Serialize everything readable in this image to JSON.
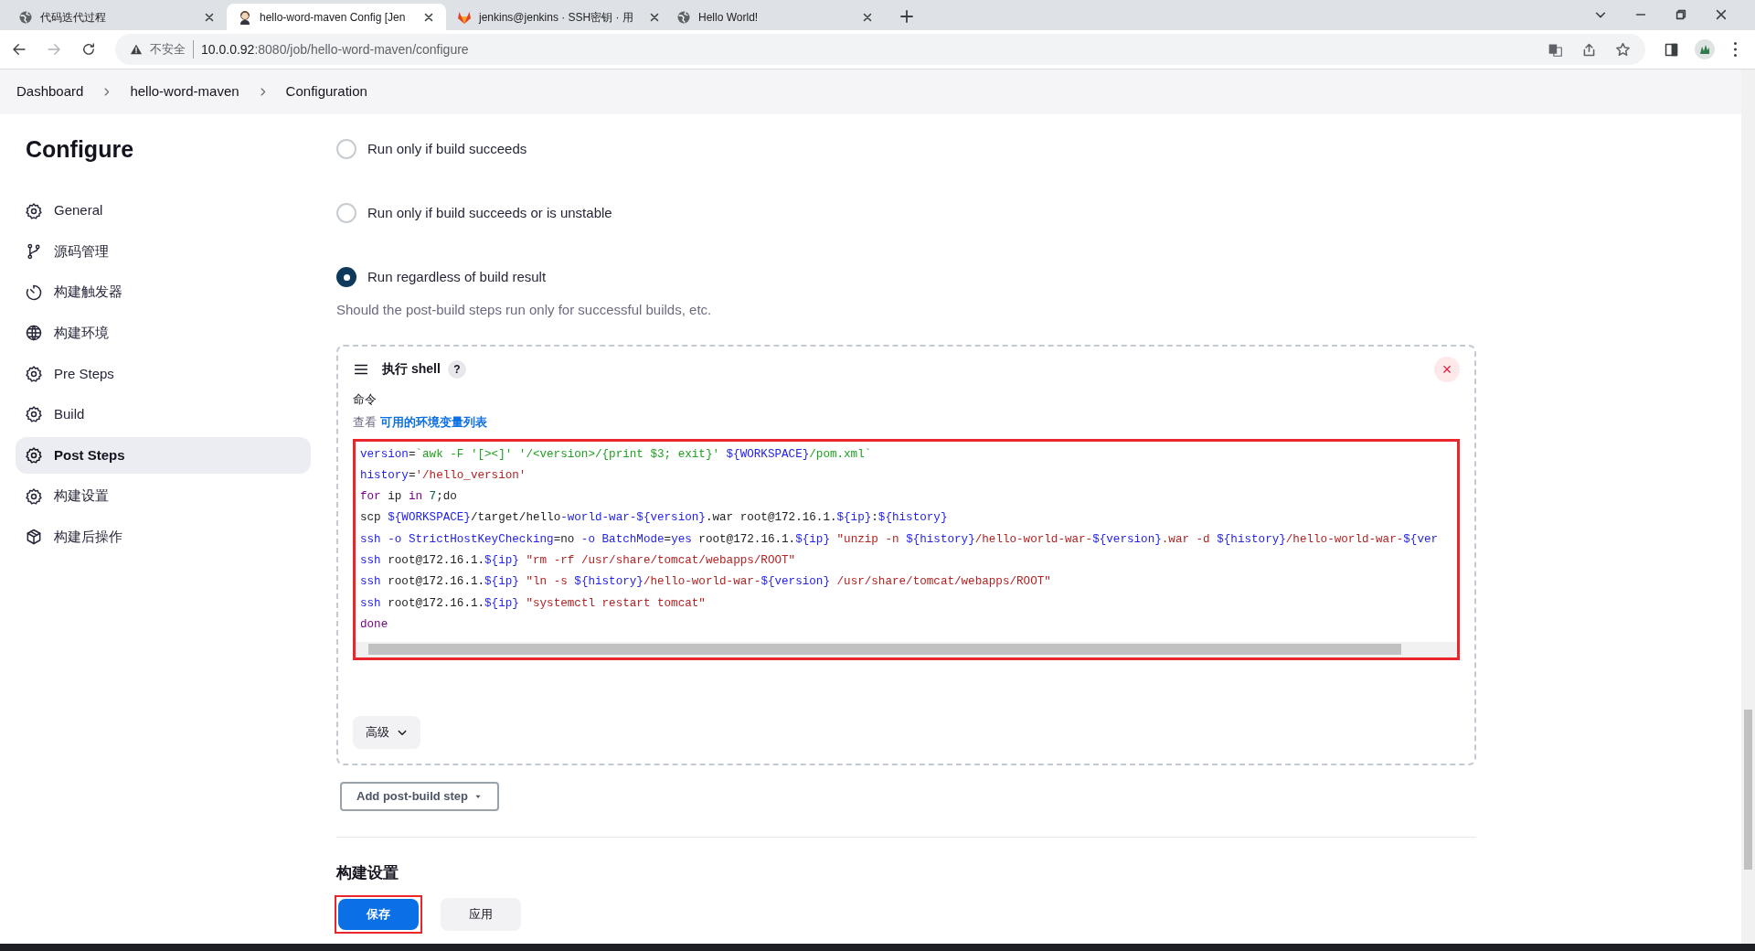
{
  "browser": {
    "tabs": [
      {
        "title": "代码迭代过程",
        "selected": false
      },
      {
        "title": "hello-word-maven Config [Jen",
        "selected": true
      },
      {
        "title": "jenkins@jenkins · SSH密钥 · 用",
        "selected": false
      },
      {
        "title": "Hello World!",
        "selected": false
      }
    ],
    "security": "不安全",
    "url_host": "10.0.0.92",
    "url_rest": ":8080/job/hello-word-maven/configure"
  },
  "breadcrumbs": [
    "Dashboard",
    "hello-word-maven",
    "Configuration"
  ],
  "sidebar": {
    "title": "Configure",
    "items": [
      {
        "label": "General",
        "selected": false
      },
      {
        "label": "源码管理",
        "selected": false
      },
      {
        "label": "构建触发器",
        "selected": false
      },
      {
        "label": "构建环境",
        "selected": false
      },
      {
        "label": "Pre Steps",
        "selected": false
      },
      {
        "label": "Build",
        "selected": false
      },
      {
        "label": "Post Steps",
        "selected": true
      },
      {
        "label": "构建设置",
        "selected": false
      },
      {
        "label": "构建后操作",
        "selected": false
      }
    ]
  },
  "run_options": [
    {
      "label": "Run only if build succeeds",
      "selected": false
    },
    {
      "label": "Run only if build succeeds or is unstable",
      "selected": false
    },
    {
      "label": "Run regardless of build result",
      "selected": true
    }
  ],
  "run_options_help": "Should the post-build steps run only for successful builds, etc.",
  "shell_step": {
    "title": "执行 shell",
    "help": "?",
    "close": "×",
    "command_label": "命令",
    "env_prefix": "查看",
    "env_link": "可用的环境变量列表",
    "code_lines": [
      [
        {
          "kind": "var",
          "text": "version"
        },
        {
          "kind": "plain",
          "text": "="
        },
        {
          "kind": "cmd",
          "text": "`awk -F '[><]' '/<version>/{print $3; exit}' "
        },
        {
          "kind": "var",
          "text": "${WORKSPACE}"
        },
        {
          "kind": "cmd",
          "text": "/pom.xml`"
        }
      ],
      [
        {
          "kind": "var",
          "text": "history"
        },
        {
          "kind": "plain",
          "text": "="
        },
        {
          "kind": "str",
          "text": "'/hello_version'"
        }
      ],
      [
        {
          "kind": "kw",
          "text": "for"
        },
        {
          "kind": "plain",
          "text": " ip "
        },
        {
          "kind": "kw",
          "text": "in"
        },
        {
          "kind": "num",
          "text": " 7"
        },
        {
          "kind": "plain",
          "text": ";do"
        }
      ],
      [
        {
          "kind": "plain",
          "text": "scp "
        },
        {
          "kind": "var",
          "text": "${WORKSPACE}"
        },
        {
          "kind": "plain",
          "text": "/target/hello"
        },
        {
          "kind": "var",
          "text": "-world-war-${version}"
        },
        {
          "kind": "plain",
          "text": ".war root@172.16.1."
        },
        {
          "kind": "var",
          "text": "${ip}"
        },
        {
          "kind": "plain",
          "text": ":"
        },
        {
          "kind": "var",
          "text": "${history}"
        }
      ],
      [
        {
          "kind": "var",
          "text": "ssh -o StrictHostKeyChecking"
        },
        {
          "kind": "plain",
          "text": "=no "
        },
        {
          "kind": "var",
          "text": "-o BatchMode"
        },
        {
          "kind": "plain",
          "text": "="
        },
        {
          "kind": "var",
          "text": "yes"
        },
        {
          "kind": "plain",
          "text": " root@172.16.1."
        },
        {
          "kind": "var",
          "text": "${ip}"
        },
        {
          "kind": "str",
          "text": " \"unzip -n "
        },
        {
          "kind": "var",
          "text": "${history}"
        },
        {
          "kind": "str",
          "text": "/hello-world-war-"
        },
        {
          "kind": "var",
          "text": "${version}"
        },
        {
          "kind": "str",
          "text": ".war -d "
        },
        {
          "kind": "var",
          "text": "${history}"
        },
        {
          "kind": "str",
          "text": "/hello-world-war-"
        },
        {
          "kind": "var",
          "text": "${ver"
        }
      ],
      [
        {
          "kind": "var",
          "text": "ssh"
        },
        {
          "kind": "plain",
          "text": " root@172.16.1."
        },
        {
          "kind": "var",
          "text": "${ip}"
        },
        {
          "kind": "str",
          "text": " \"rm -rf /usr/share/tomcat/webapps/ROOT\""
        }
      ],
      [
        {
          "kind": "var",
          "text": "ssh"
        },
        {
          "kind": "plain",
          "text": " root@172.16.1."
        },
        {
          "kind": "var",
          "text": "${ip}"
        },
        {
          "kind": "str",
          "text": " \"ln -s "
        },
        {
          "kind": "var",
          "text": "${history}"
        },
        {
          "kind": "str",
          "text": "/hello-world-war-"
        },
        {
          "kind": "var",
          "text": "${version}"
        },
        {
          "kind": "str",
          "text": " /usr/share/tomcat/webapps/ROOT\""
        }
      ],
      [
        {
          "kind": "var",
          "text": "ssh"
        },
        {
          "kind": "plain",
          "text": " root@172.16.1."
        },
        {
          "kind": "var",
          "text": "${ip}"
        },
        {
          "kind": "str",
          "text": " \"systemctl restart tomcat\""
        }
      ],
      [
        {
          "kind": "kw",
          "text": "done"
        }
      ]
    ],
    "advanced": "高级"
  },
  "add_step": "Add post-build step",
  "next_section": "构建设置",
  "save": "保存",
  "apply": "应用"
}
